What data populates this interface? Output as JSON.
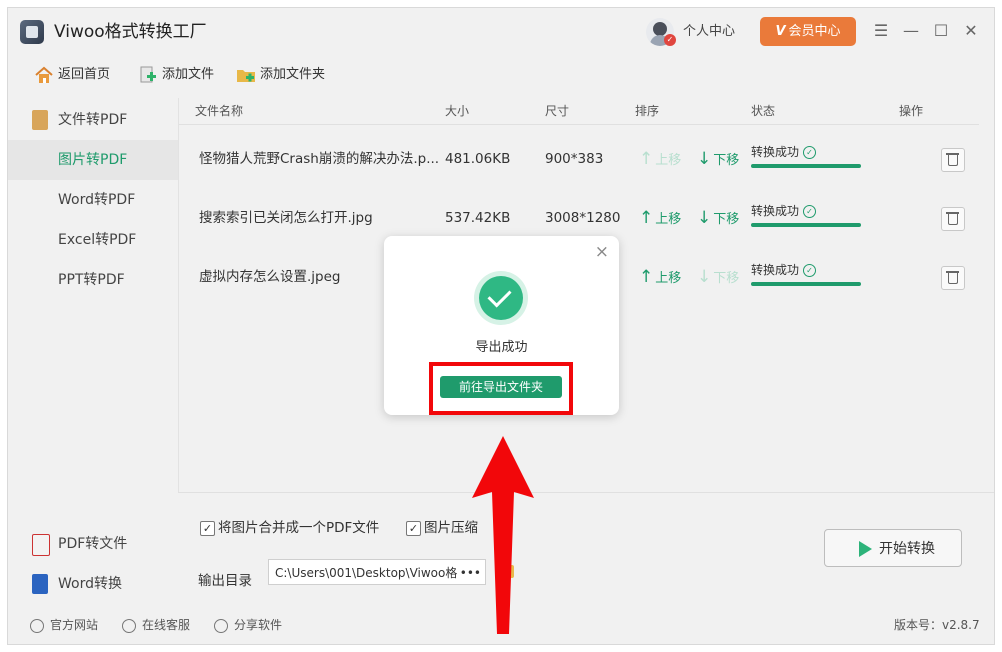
{
  "app": {
    "title": "Viwoo格式转换工厂"
  },
  "header": {
    "user_center": "个人中心",
    "vip_label": "会员中心",
    "vip_icon": "V"
  },
  "window_controls": {
    "menu": "☰",
    "minimize": "—",
    "maximize": "☐",
    "close": "✕"
  },
  "toolbar": {
    "home": "返回首页",
    "add_file": "添加文件",
    "add_folder": "添加文件夹"
  },
  "sidebar": {
    "items": [
      {
        "label": "文件转PDF"
      },
      {
        "label": "图片转PDF"
      },
      {
        "label": "Word转PDF"
      },
      {
        "label": "Excel转PDF"
      },
      {
        "label": "PPT转PDF"
      }
    ],
    "bottom": [
      {
        "label": "PDF转文件"
      },
      {
        "label": "Word转换"
      }
    ]
  },
  "table": {
    "headers": {
      "name": "文件名称",
      "size": "大小",
      "dimensions": "尺寸",
      "order": "排序",
      "status": "状态",
      "action": "操作"
    },
    "move_up": "上移",
    "move_down": "下移",
    "rows": [
      {
        "name": "怪物猎人荒野Crash崩溃的解决办法.p...",
        "size": "481.06KB",
        "dimensions": "900*383",
        "status": "转换成功",
        "progress": 1.0
      },
      {
        "name": "搜索索引已关闭怎么打开.jpg",
        "size": "537.42KB",
        "dimensions": "3008*1280",
        "status": "转换成功",
        "progress": 1.0
      },
      {
        "name": "虚拟内存怎么设置.jpeg",
        "size": "",
        "dimensions": "",
        "status": "转换成功",
        "progress": 1.0
      }
    ]
  },
  "options": {
    "merge_label": "将图片合并成一个PDF文件",
    "merge_checked": "✓",
    "compress_label": "图片压缩",
    "compress_checked": "✓"
  },
  "output": {
    "label": "输出目录",
    "path": "C:\\Users\\001\\Desktop\\Viwoo格式",
    "ellipsis": "•••"
  },
  "start_button": {
    "label": "开始转换"
  },
  "footer": {
    "website": "官方网站",
    "service": "在线客服",
    "share": "分享软件",
    "version": "版本号：v2.8.7"
  },
  "modal": {
    "message": "导出成功",
    "button": "前往导出文件夹",
    "close": "×"
  },
  "colors": {
    "accent": "#1f9b6c",
    "vip": "#ea7a3a",
    "annotation": "#f2070a"
  }
}
